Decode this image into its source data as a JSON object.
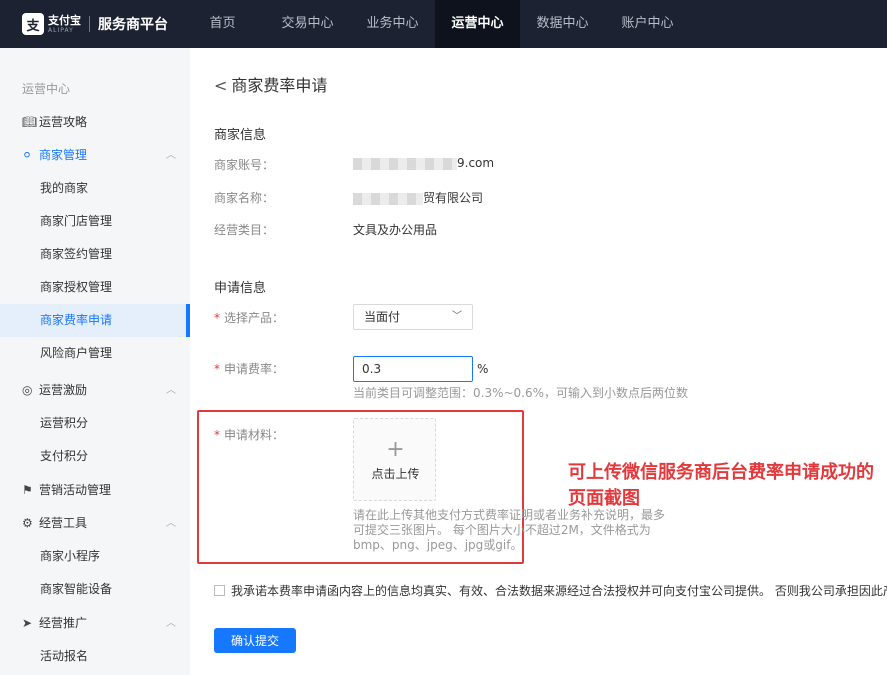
{
  "header": {
    "logo_text": "支付宝",
    "logo_sub": "ALIPAY",
    "brand": "服务商平台",
    "nav": [
      "首页",
      "交易中心",
      "业务中心",
      "运营中心",
      "数据中心",
      "账户中心"
    ]
  },
  "sidebar": {
    "title": "运营中心",
    "items": [
      {
        "label": "运营攻略",
        "icon": "book-icon"
      },
      {
        "label": "商家管理",
        "icon": "user-icon"
      },
      {
        "label": "我的商家"
      },
      {
        "label": "商家门店管理"
      },
      {
        "label": "商家签约管理"
      },
      {
        "label": "商家授权管理"
      },
      {
        "label": "商家费率申请"
      },
      {
        "label": "风险商户管理"
      },
      {
        "label": "运营激励",
        "icon": "award-icon"
      },
      {
        "label": "运营积分"
      },
      {
        "label": "支付积分"
      },
      {
        "label": "营销活动管理",
        "icon": "flag-icon"
      },
      {
        "label": "经营工具",
        "icon": "gear-icon"
      },
      {
        "label": "商家小程序"
      },
      {
        "label": "商家智能设备"
      },
      {
        "label": "经营推广",
        "icon": "send-icon"
      },
      {
        "label": "活动报名"
      }
    ]
  },
  "page": {
    "title": "商家费率申请",
    "merchant_info": {
      "title": "商家信息",
      "account_label": "商家账号：",
      "account_value": "9.com",
      "name_label": "商家名称：",
      "name_value": "贸有限公司",
      "category_label": "经营类目：",
      "category_value": "文具及办公用品"
    },
    "apply_info": {
      "title": "申请信息",
      "product_label": "选择产品：",
      "product_value": "当面付",
      "rate_label": "申请费率：",
      "rate_value": "0.3",
      "rate_unit": "%",
      "rate_hint": "当前类目可调整范围：0.3%~0.6%，可输入到小数点后两位数",
      "material_label": "申请材料：",
      "upload_label": "点击上传",
      "upload_desc": "请在此上传其他支付方式费率证明或者业务补充说明，最多可提交三张图片。 每个图片大小不超过2M，文件格式为bmp、png、jpeg、jpg或gif。"
    },
    "annotation": "可上传微信服务商后台费率申请成功的页面截图",
    "agreement": "我承诺本费率申请函内容上的信息均真实、有效、合法数据来源经过合法授权并可向支付宝公司提供。 否则我公司承担因此产生的法律责任。",
    "submit_label": "确认提交"
  },
  "colors": {
    "accent": "#1677ff",
    "topbar": "#1c2232",
    "annotation": "#e4393c"
  }
}
